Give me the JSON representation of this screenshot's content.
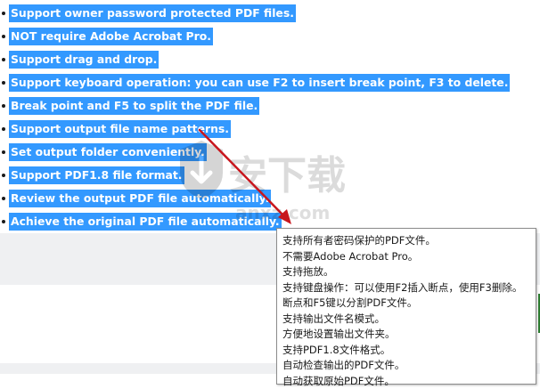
{
  "features": [
    "Support owner password protected PDF files.",
    "NOT require Adobe Acrobat Pro.",
    "Support drag and drop.",
    "Support keyboard operation: you can use F2 to insert break point, F3 to delete.",
    "Break point and F5 to split the PDF file.",
    "Support output file name patterns.",
    "Set output folder conveniently.",
    "Support PDF1.8 file format.",
    "Review the output PDF file automatically.",
    "Achieve the original PDF file automatically."
  ],
  "tooltip_lines": [
    "支持所有者密码保护的PDF文件。",
    "不需要Adobe Acrobat Pro。",
    "支持拖放。",
    "支持键盘操作：可以使用F2插入断点，使用F3删除。",
    "断点和F5键以分割PDF文件。",
    "支持输出文件名模式。",
    "方便地设置输出文件夹。",
    "支持PDF1.8文件格式。",
    "自动检查输出的PDF文件。",
    "自动获取原始PDF文件。"
  ],
  "watermark": {
    "main": "安下载",
    "sub": "anxz.com"
  },
  "icons": {
    "watermark_logo": "shield-download-icon",
    "annotation_arrow": "red-arrow-icon"
  },
  "colors": {
    "selection": "#3399ff",
    "arrow": "#c8161d",
    "panel_gray": "#eff0f2",
    "accent_green": "#2e7d32"
  }
}
